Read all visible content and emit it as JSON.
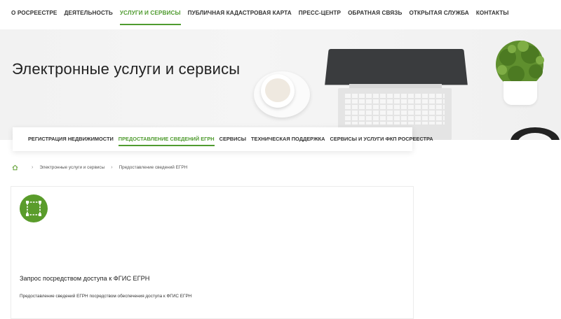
{
  "topnav": {
    "items": [
      {
        "label": "О РОСРЕЕСТРЕ"
      },
      {
        "label": "ДЕЯТЕЛЬНОСТЬ"
      },
      {
        "label": "УСЛУГИ И СЕРВИСЫ"
      },
      {
        "label": "ПУБЛИЧНАЯ КАДАСТРОВАЯ КАРТА"
      },
      {
        "label": "ПРЕСС-ЦЕНТР"
      },
      {
        "label": "ОБРАТНАЯ СВЯЗЬ"
      },
      {
        "label": "ОТКРЫТАЯ СЛУЖБА"
      },
      {
        "label": "КОНТАКТЫ"
      }
    ],
    "active_index": 2
  },
  "hero": {
    "title": "Электронные услуги и сервисы"
  },
  "subnav": {
    "items": [
      {
        "label": "РЕГИСТРАЦИЯ НЕДВИЖИМОСТИ"
      },
      {
        "label": "ПРЕДОСТАВЛЕНИЕ СВЕДЕНИЙ ЕГРН"
      },
      {
        "label": "СЕРВИСЫ"
      },
      {
        "label": "ТЕХНИЧЕСКАЯ ПОДДЕРЖКА"
      },
      {
        "label": "СЕРВИСЫ И УСЛУГИ ФКП РОСРЕЕСТРА"
      }
    ],
    "active_index": 1
  },
  "breadcrumb": {
    "home_icon": "home-icon",
    "items": [
      {
        "label": "Электронные услуги и сервисы"
      },
      {
        "label": "Предоставление сведений ЕГРН"
      }
    ]
  },
  "service_card": {
    "icon": "map-frame-icon",
    "title": "Запрос посредством доступа к ФГИС ЕГРН",
    "description": "Предоставление сведений ЕГРН посредством обеспечения доступа к ФГИС ЕГРН"
  },
  "colors": {
    "accent": "#4f9b2f",
    "badge": "#5a9c2b",
    "text": "#222222"
  }
}
